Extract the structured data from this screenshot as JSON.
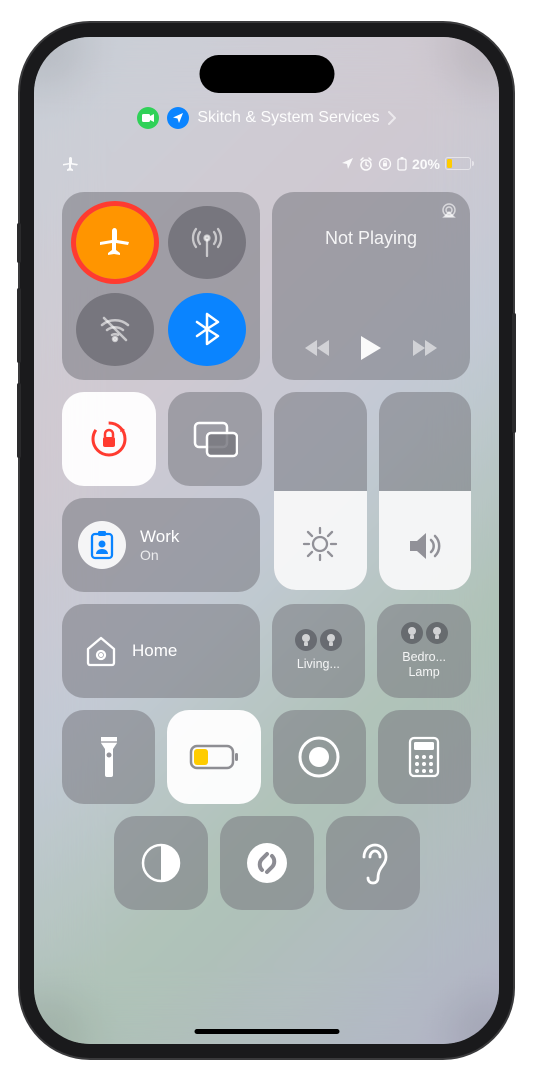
{
  "pills": {
    "app_status": "Skitch & System Services"
  },
  "status": {
    "battery_pct": "20%",
    "battery_fill": "20%"
  },
  "connectivity": {
    "airplane": true,
    "cellular": false,
    "wifi": false,
    "bluetooth": true
  },
  "media": {
    "title": "Not Playing"
  },
  "focus": {
    "name": "Work",
    "state": "On"
  },
  "sliders": {
    "brightness": "50%",
    "volume": "50%"
  },
  "home": {
    "label": "Home",
    "room1": "Living...",
    "room2_l1": "Bedro...",
    "room2_l2": "Lamp"
  }
}
